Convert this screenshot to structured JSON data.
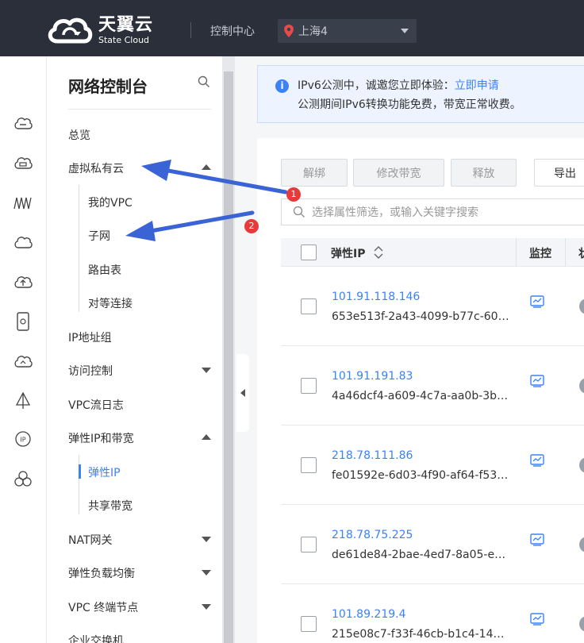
{
  "header": {
    "logo_cn": "天翼云",
    "logo_en": "State Cloud",
    "console_label": "控制中心",
    "region": "上海4"
  },
  "rail": {
    "icons": [
      "menu-icon",
      "cloud-server-icon",
      "cloud-disk-icon",
      "network-wave-icon",
      "cloud-icon",
      "cloud-upload-icon",
      "phone-icon",
      "cloud-sync-icon",
      "sail-icon",
      "ip-icon",
      "cluster-icon"
    ]
  },
  "nav": {
    "title": "网络控制台",
    "items": {
      "overview": "总览",
      "vpc": "虚拟私有云",
      "my_vpc": "我的VPC",
      "subnet": "子网",
      "route_table": "路由表",
      "peering": "对等连接",
      "ip_group": "IP地址组",
      "access_control": "访问控制",
      "vpc_flow_log": "VPC流日志",
      "eip_bandwidth": "弹性IP和带宽",
      "eip": "弹性IP",
      "shared_bandwidth": "共享带宽",
      "nat": "NAT网关",
      "elb": "弹性负载均衡",
      "vpc_endpoint": "VPC 终端节点",
      "switch": "企业交换机"
    }
  },
  "notice": {
    "line1_text": "IPv6公测中，诚邀您立即体验：",
    "line1_link": "立即申请",
    "line2": "公测期间IPv6转换功能免费，带宽正常收费。"
  },
  "toolbar": {
    "unbind": "解绑",
    "modify_bandwidth": "修改带宽",
    "release": "释放",
    "export": "导出"
  },
  "search": {
    "placeholder": "选择属性筛选，或输入关键字搜索"
  },
  "table": {
    "col_ip": "弹性IP",
    "col_monitor": "监控",
    "col_status": "状",
    "rows": [
      {
        "ip": "101.91.118.146",
        "id": "653e513f-2a43-4099-b77c-606..."
      },
      {
        "ip": "101.91.191.83",
        "id": "4a46dcf4-a609-4c7a-aa0b-3b5..."
      },
      {
        "ip": "218.78.111.86",
        "id": "fe01592e-6d03-4f90-af64-f533..."
      },
      {
        "ip": "218.78.75.225",
        "id": "de61de84-2bae-4ed7-8a05-e2..."
      },
      {
        "ip": "101.89.219.4",
        "id": "215e08c7-f33f-46cb-b1c4-14e..."
      }
    ]
  },
  "annotations": {
    "badge1": "1",
    "badge2": "2"
  },
  "colors": {
    "header_bg": "#2b2f3a",
    "accent": "#3b82f6",
    "annotation_arrow": "#3a63d6",
    "annotation_badge": "#e83a3a"
  }
}
